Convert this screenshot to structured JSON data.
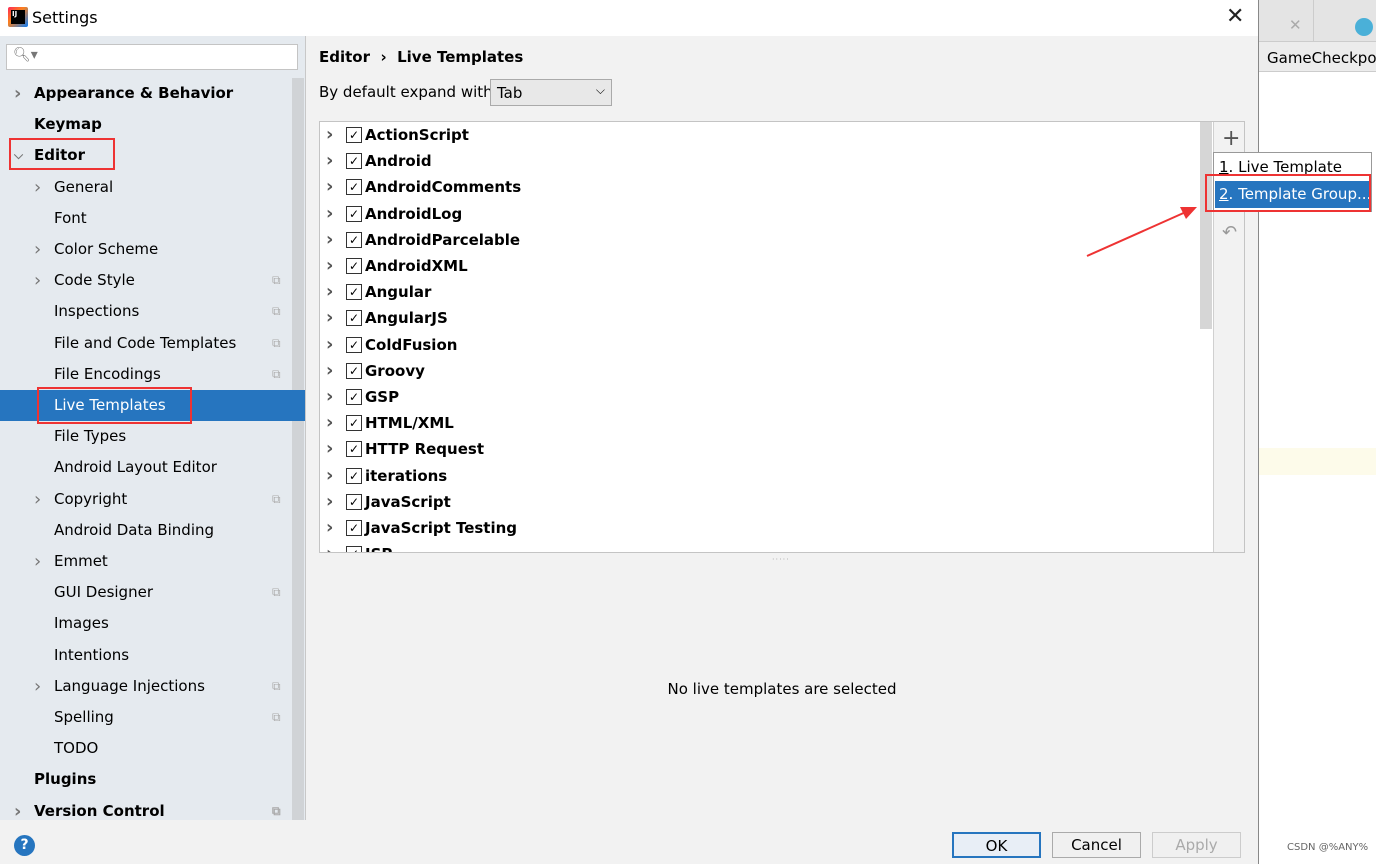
{
  "window": {
    "title": "Settings",
    "close_icon": "close-icon"
  },
  "search": {
    "placeholder": "",
    "icon": "search-icon"
  },
  "sidebar": {
    "items": [
      {
        "label": "Appearance & Behavior",
        "level": 0,
        "bold": true,
        "expandable": true,
        "expanded": false,
        "copy": false
      },
      {
        "label": "Keymap",
        "level": 0,
        "bold": true,
        "expandable": false,
        "copy": false
      },
      {
        "label": "Editor",
        "level": 0,
        "bold": true,
        "expandable": true,
        "expanded": true,
        "copy": false
      },
      {
        "label": "General",
        "level": 1,
        "expandable": true,
        "copy": false
      },
      {
        "label": "Font",
        "level": 1,
        "expandable": false,
        "copy": false
      },
      {
        "label": "Color Scheme",
        "level": 1,
        "expandable": true,
        "copy": false
      },
      {
        "label": "Code Style",
        "level": 1,
        "expandable": true,
        "copy": true
      },
      {
        "label": "Inspections",
        "level": 1,
        "expandable": false,
        "copy": true
      },
      {
        "label": "File and Code Templates",
        "level": 1,
        "expandable": false,
        "copy": true
      },
      {
        "label": "File Encodings",
        "level": 1,
        "expandable": false,
        "copy": true
      },
      {
        "label": "Live Templates",
        "level": 1,
        "expandable": false,
        "copy": false,
        "selected": true
      },
      {
        "label": "File Types",
        "level": 1,
        "expandable": false,
        "copy": false
      },
      {
        "label": "Android Layout Editor",
        "level": 1,
        "expandable": false,
        "copy": false
      },
      {
        "label": "Copyright",
        "level": 1,
        "expandable": true,
        "copy": true
      },
      {
        "label": "Android Data Binding",
        "level": 1,
        "expandable": false,
        "copy": false
      },
      {
        "label": "Emmet",
        "level": 1,
        "expandable": true,
        "copy": false
      },
      {
        "label": "GUI Designer",
        "level": 1,
        "expandable": false,
        "copy": true
      },
      {
        "label": "Images",
        "level": 1,
        "expandable": false,
        "copy": false
      },
      {
        "label": "Intentions",
        "level": 1,
        "expandable": false,
        "copy": false
      },
      {
        "label": "Language Injections",
        "level": 1,
        "expandable": true,
        "copy": true
      },
      {
        "label": "Spelling",
        "level": 1,
        "expandable": false,
        "copy": true
      },
      {
        "label": "TODO",
        "level": 1,
        "expandable": false,
        "copy": false
      },
      {
        "label": "Plugins",
        "level": 0,
        "bold": true,
        "expandable": false,
        "copy": false
      },
      {
        "label": "Version Control",
        "level": 0,
        "bold": true,
        "expandable": true,
        "expanded": false,
        "copy": true
      }
    ]
  },
  "breadcrumb": {
    "parent": "Editor",
    "separator": "›",
    "current": "Live Templates"
  },
  "expand": {
    "label": "By default expand with",
    "value": "Tab"
  },
  "templates": [
    "ActionScript",
    "Android",
    "AndroidComments",
    "AndroidLog",
    "AndroidParcelable",
    "AndroidXML",
    "Angular",
    "AngularJS",
    "ColdFusion",
    "Groovy",
    "GSP",
    "HTML/XML",
    "HTTP Request",
    "iterations",
    "JavaScript",
    "JavaScript Testing",
    "JSP"
  ],
  "toolbar": {
    "add_icon": "plus-icon",
    "revert_icon": "undo-icon"
  },
  "popup": {
    "items": [
      {
        "mnemonic": "1",
        "label": ". Live Template"
      },
      {
        "mnemonic": "2",
        "label": ". Template Group..."
      }
    ]
  },
  "empty_message": "No live templates are selected",
  "buttons": {
    "ok": "OK",
    "cancel": "Cancel",
    "apply": "Apply",
    "help": "?"
  },
  "background_window": {
    "tab": "GameCheckpoi"
  },
  "watermark": "CSDN @%ANY%",
  "colors": {
    "selection": "#2675bf",
    "annotation": "#ee3333"
  }
}
